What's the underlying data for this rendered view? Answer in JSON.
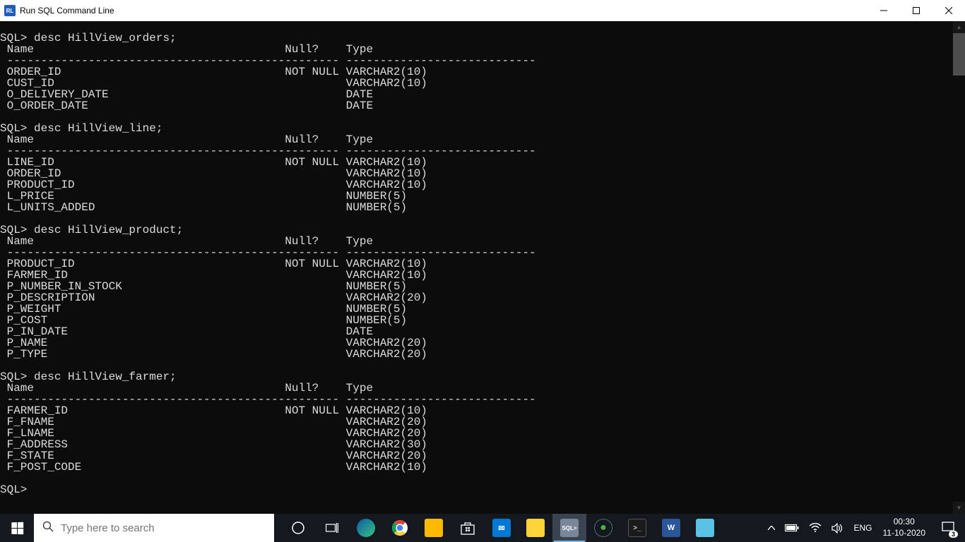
{
  "window": {
    "app_icon_text": "RL",
    "title": "Run SQL Command Line"
  },
  "terminal": {
    "prompt": "SQL>",
    "col_name": "Name",
    "col_null": "Null?",
    "col_type": "Type",
    "not_null": "NOT NULL",
    "blocks": [
      {
        "command": "desc HillView_orders;",
        "rows": [
          {
            "name": "ORDER_ID",
            "null": "NOT NULL",
            "type": "VARCHAR2(10)"
          },
          {
            "name": "CUST_ID",
            "null": "",
            "type": "VARCHAR2(10)"
          },
          {
            "name": "O_DELIVERY_DATE",
            "null": "",
            "type": "DATE"
          },
          {
            "name": "O_ORDER_DATE",
            "null": "",
            "type": "DATE"
          }
        ]
      },
      {
        "command": "desc HillView_line;",
        "rows": [
          {
            "name": "LINE_ID",
            "null": "NOT NULL",
            "type": "VARCHAR2(10)"
          },
          {
            "name": "ORDER_ID",
            "null": "",
            "type": "VARCHAR2(10)"
          },
          {
            "name": "PRODUCT_ID",
            "null": "",
            "type": "VARCHAR2(10)"
          },
          {
            "name": "L_PRICE",
            "null": "",
            "type": "NUMBER(5)"
          },
          {
            "name": "L_UNITS_ADDED",
            "null": "",
            "type": "NUMBER(5)"
          }
        ]
      },
      {
        "command": "desc HillView_product;",
        "rows": [
          {
            "name": "PRODUCT_ID",
            "null": "NOT NULL",
            "type": "VARCHAR2(10)"
          },
          {
            "name": "FARMER_ID",
            "null": "",
            "type": "VARCHAR2(10)"
          },
          {
            "name": "P_NUMBER_IN_STOCK",
            "null": "",
            "type": "NUMBER(5)"
          },
          {
            "name": "P_DESCRIPTION",
            "null": "",
            "type": "VARCHAR2(20)"
          },
          {
            "name": "P_WEIGHT",
            "null": "",
            "type": "NUMBER(5)"
          },
          {
            "name": "P_COST",
            "null": "",
            "type": "NUMBER(5)"
          },
          {
            "name": "P_IN_DATE",
            "null": "",
            "type": "DATE"
          },
          {
            "name": "P_NAME",
            "null": "",
            "type": "VARCHAR2(20)"
          },
          {
            "name": "P_TYPE",
            "null": "",
            "type": "VARCHAR2(20)"
          }
        ]
      },
      {
        "command": "desc HillView_farmer;",
        "rows": [
          {
            "name": "FARMER_ID",
            "null": "NOT NULL",
            "type": "VARCHAR2(10)"
          },
          {
            "name": "F_FNAME",
            "null": "",
            "type": "VARCHAR2(20)"
          },
          {
            "name": "F_LNAME",
            "null": "",
            "type": "VARCHAR2(20)"
          },
          {
            "name": "F_ADDRESS",
            "null": "",
            "type": "VARCHAR2(30)"
          },
          {
            "name": "F_STATE",
            "null": "",
            "type": "VARCHAR2(20)"
          },
          {
            "name": "F_POST_CODE",
            "null": "",
            "type": "VARCHAR2(10)"
          }
        ]
      }
    ]
  },
  "taskbar": {
    "search_placeholder": "Type here to search",
    "lang": "ENG",
    "time": "00:30",
    "date": "11-10-2020",
    "notif_count": "3"
  }
}
